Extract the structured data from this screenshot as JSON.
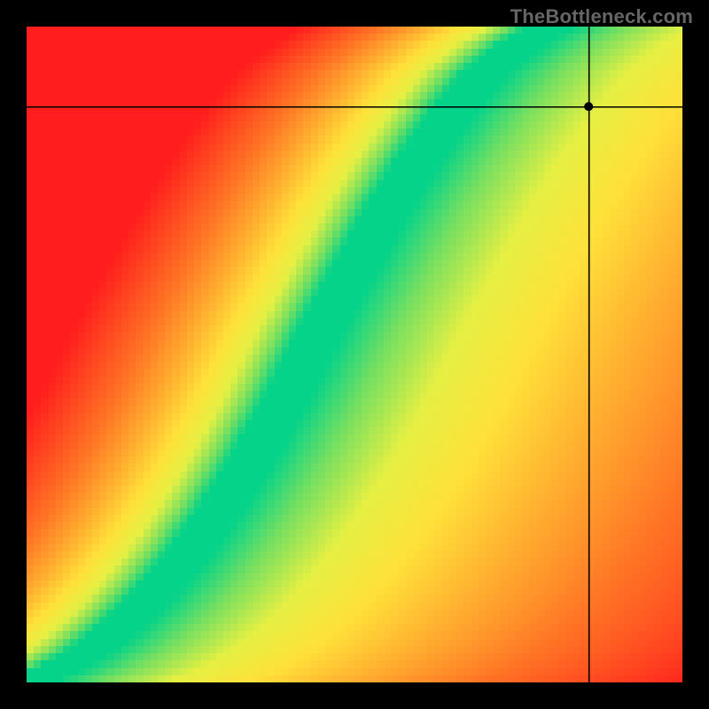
{
  "branding": {
    "watermark": "TheBottleneck.com"
  },
  "crosshair": {
    "x_frac": 0.857,
    "y_frac": 0.122
  },
  "chart_data": {
    "type": "heatmap",
    "title": "",
    "xlabel": "",
    "ylabel": "",
    "xlim": [
      0,
      1
    ],
    "ylim": [
      0,
      1
    ],
    "grid_resolution": 90,
    "color_scale": {
      "description": "red→orange→yellow→green→yellow→orange→red as distance from optimal curve increases",
      "stops": [
        {
          "t": 0.0,
          "hex": "#05d38a"
        },
        {
          "t": 0.08,
          "hex": "#79e060"
        },
        {
          "t": 0.18,
          "hex": "#e6f043"
        },
        {
          "t": 0.3,
          "hex": "#ffe13a"
        },
        {
          "t": 0.45,
          "hex": "#ffb030"
        },
        {
          "t": 0.65,
          "hex": "#ff7425"
        },
        {
          "t": 1.0,
          "hex": "#ff1d1d"
        }
      ]
    },
    "optimal_curve": {
      "description": "y as a function of x along the green optimal band (normalized 0-1, origin bottom-left)",
      "points": [
        {
          "x": 0.0,
          "y": 0.0
        },
        {
          "x": 0.05,
          "y": 0.02
        },
        {
          "x": 0.1,
          "y": 0.05
        },
        {
          "x": 0.15,
          "y": 0.09
        },
        {
          "x": 0.2,
          "y": 0.14
        },
        {
          "x": 0.25,
          "y": 0.2
        },
        {
          "x": 0.3,
          "y": 0.27
        },
        {
          "x": 0.35,
          "y": 0.35
        },
        {
          "x": 0.4,
          "y": 0.44
        },
        {
          "x": 0.45,
          "y": 0.54
        },
        {
          "x": 0.5,
          "y": 0.63
        },
        {
          "x": 0.55,
          "y": 0.72
        },
        {
          "x": 0.6,
          "y": 0.8
        },
        {
          "x": 0.65,
          "y": 0.87
        },
        {
          "x": 0.7,
          "y": 0.93
        },
        {
          "x": 0.75,
          "y": 0.97
        },
        {
          "x": 0.8,
          "y": 1.0
        }
      ]
    },
    "asymmetry": {
      "description": "Right/above-curve side fades to yellow (mild), left/below-curve side fades to red (severe).",
      "left_scale": 2.6,
      "right_scale": 0.9
    },
    "band_halfwidth_x": 0.035,
    "marker": {
      "x": 0.857,
      "y": 0.878,
      "note": "y given in plot coords, origin bottom-left"
    }
  }
}
